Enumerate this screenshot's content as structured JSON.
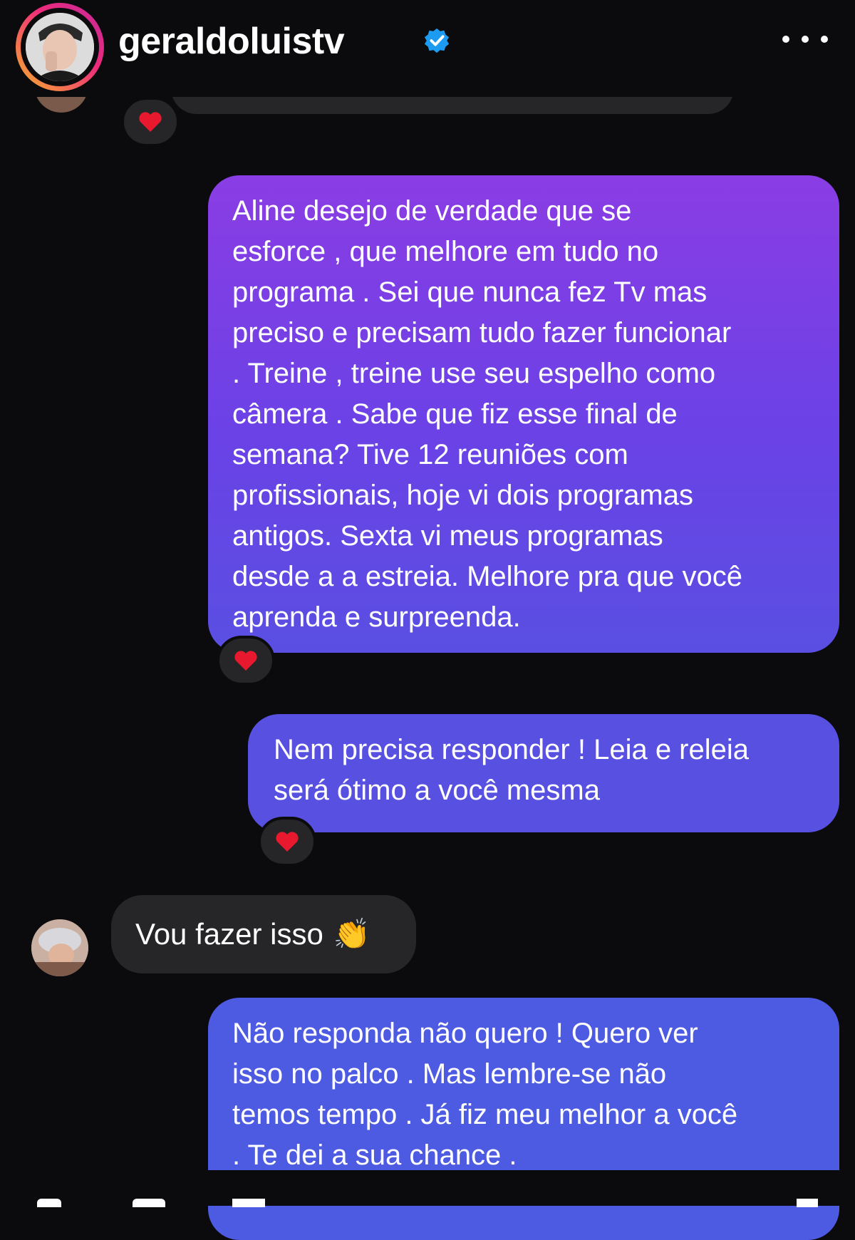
{
  "header": {
    "username": "geraldoluistv",
    "verified_icon": "verified-badge-icon",
    "more_icon": "more-options-icon",
    "verified_color": "#1d9bf0"
  },
  "messages": [
    {
      "sender": "me",
      "lines": [
        "Aline desejo de verdade que se",
        "esforce , que melhore em tudo no",
        "programa . Sei que nunca fez Tv mas",
        "preciso e precisam tudo fazer funcionar",
        ". Treine , treine use seu espelho como",
        "câmera . Sabe que fiz esse final de",
        "semana? Tive 12 reuniões com",
        "profissionais, hoje vi dois programas",
        "antigos. Sexta vi meus programas",
        "desde a a estreia. Melhore pra que você",
        "aprenda e surpreenda."
      ],
      "reaction": "heart"
    },
    {
      "sender": "me",
      "lines": [
        "Nem precisa responder ! Leia e releia",
        "será ótimo a você mesma"
      ],
      "reaction": "heart"
    },
    {
      "sender": "other",
      "text": "Vou fazer isso",
      "emoji": "👏"
    },
    {
      "sender": "me",
      "lines": [
        "Não responda não quero ! Quero ver",
        "isso no palco . Mas lembre-se não",
        "temos tempo . Já fiz meu melhor a você",
        ". Te dei a sua chance ."
      ]
    }
  ],
  "colors": {
    "background": "#0b0b0d",
    "incoming_bubble": "#262629",
    "outgoing_top": "#8a3de4",
    "outgoing_bottom": "#4d5ae2",
    "heart": "#e8182f"
  }
}
